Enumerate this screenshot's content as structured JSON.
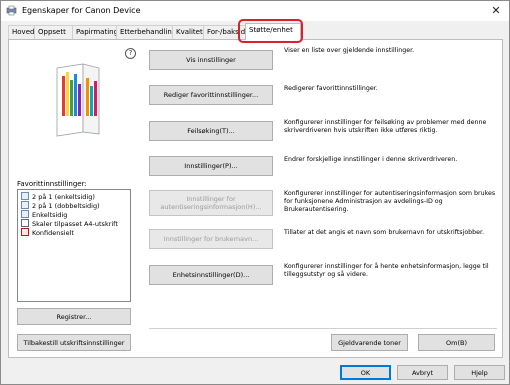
{
  "window": {
    "title": "Egenskaper for Canon Device"
  },
  "tabs": [
    {
      "label": "Hoved"
    },
    {
      "label": "Oppsett"
    },
    {
      "label": "Papirmating"
    },
    {
      "label": "Etterbehandling"
    },
    {
      "label": "Kvalitet"
    },
    {
      "label": "For-/bakside"
    },
    {
      "label": "Støtte/enhet",
      "active": true
    }
  ],
  "left": {
    "help_glyph": "?",
    "favorites_label": "Favorittinnstillinger:",
    "favorites": [
      {
        "label": "2 på 1 (enkeltsidig)",
        "icon": "page-icon"
      },
      {
        "label": "2 på 1 (dobbeltsidig)",
        "icon": "page-icon"
      },
      {
        "label": "Enkeltsidig",
        "icon": "page-icon"
      },
      {
        "label": "Skaler tilpasset A4-utskrift",
        "icon": "scale-icon"
      },
      {
        "label": "Konfidensielt",
        "icon": "confidential-icon"
      }
    ],
    "register_button": "Registrer...",
    "reset_button": "Tilbakestill utskriftsinnstillinger"
  },
  "actions": [
    {
      "button": "Vis innstillinger",
      "desc": "Viser en liste over gjeldende innstillinger.",
      "enabled": true
    },
    {
      "button": "Rediger favorittinnstillinger...",
      "desc": "Redigerer favorittinnstillinger.",
      "enabled": true
    },
    {
      "button": "Feilsøking(T)...",
      "desc": "Konfigurerer innstillinger for feilsøking av problemer med denne skriverdriveren hvis utskriften ikke utføres riktig.",
      "enabled": true
    },
    {
      "button": "Innstillinger(P)...",
      "desc": "Endrer forskjellige innstillinger i denne skriverdriveren.",
      "enabled": true
    },
    {
      "button": "Innstillinger for autentiseringsinformasjon(H)...",
      "desc": "Konfigurerer innstillinger for autentiseringsinformasjon som brukes for funksjonene Administrasjon av avdelings-ID og Brukerautentisering.",
      "enabled": false
    },
    {
      "button": "Innstillinger for brukernavn...",
      "desc": "Tillater at det angis et navn som brukernavn for utskriftsjobber.",
      "enabled": false
    },
    {
      "button": "Enhetsinnstillinger(D)...",
      "desc": "Konfigurerer innstillinger for å hente enhetsinformasjon, legge til tilleggsutstyr og så videre.",
      "enabled": true
    }
  ],
  "panel_buttons": {
    "toner": "Gjeldvarende toner",
    "about": "Om(B)"
  },
  "footer": {
    "ok": "OK",
    "cancel": "Avbryt",
    "help": "Hjelp"
  },
  "colors": {
    "highlight": "#d8232a",
    "accent": "#0078d7"
  }
}
